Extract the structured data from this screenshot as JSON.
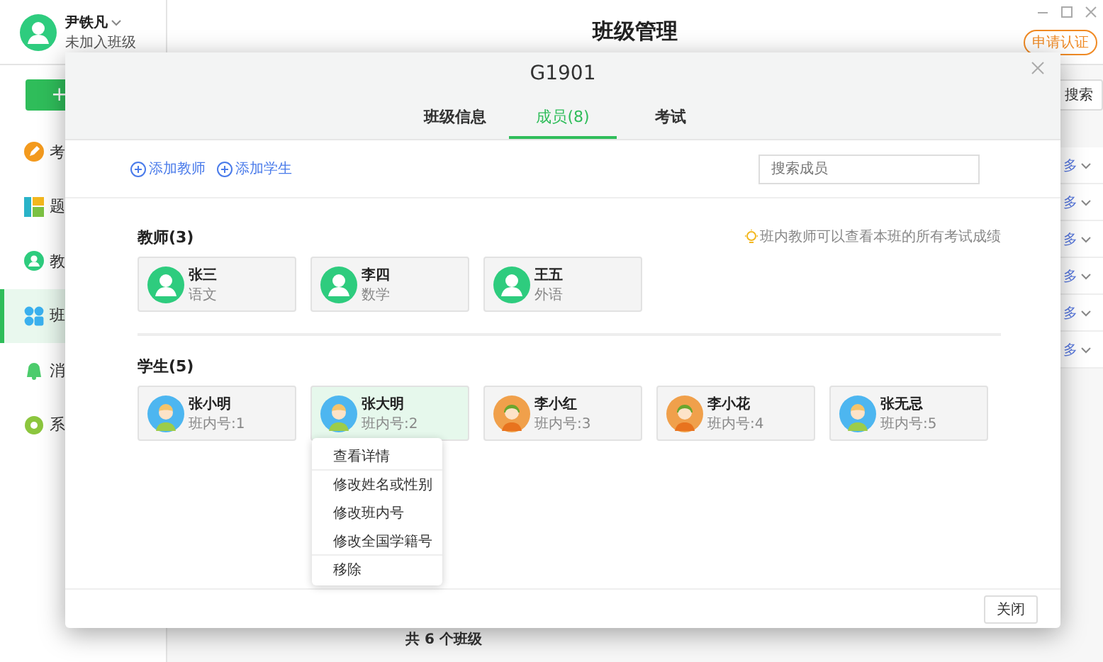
{
  "app": {
    "user": {
      "name": "尹铁凡",
      "status": "未加入班级"
    },
    "add_button": "+",
    "sidebar": {
      "items": [
        {
          "label": "考",
          "kind": "exam",
          "selected": false
        },
        {
          "label": "题",
          "kind": "bank",
          "selected": false
        },
        {
          "label": "教",
          "kind": "teacher",
          "selected": false
        },
        {
          "label": "班",
          "kind": "class",
          "selected": true
        },
        {
          "label": "消",
          "kind": "message",
          "selected": false
        },
        {
          "label": "系",
          "kind": "settings",
          "selected": false
        }
      ]
    },
    "title": "班级管理",
    "badge": "申请认证",
    "search_button": "搜索",
    "rows": [
      {
        "link": "多"
      },
      {
        "link": "多"
      },
      {
        "link": "多"
      },
      {
        "link": "多"
      },
      {
        "link": "多"
      },
      {
        "link": "多"
      }
    ],
    "footer": "共 6 个班级"
  },
  "dialog": {
    "title": "G1901",
    "tabs": [
      {
        "label": "班级信息",
        "selected": false
      },
      {
        "label": "成员(8)",
        "selected": true
      },
      {
        "label": "考试",
        "selected": false
      }
    ],
    "actions": [
      "添加教师",
      "添加学生"
    ],
    "search": {
      "placeholder": "搜索成员"
    },
    "teachers": {
      "heading": "教师(3)",
      "hint": "班内教师可以查看本班的所有考试成绩",
      "members": [
        {
          "name": "张三",
          "detail": "语文"
        },
        {
          "name": "李四",
          "detail": "数学"
        },
        {
          "name": "王五",
          "detail": "外语"
        }
      ]
    },
    "students": {
      "heading": "学生(5)",
      "members": [
        {
          "name": "张小明",
          "detail": "班内号:1",
          "kind": "boy",
          "selected": false
        },
        {
          "name": "张大明",
          "detail": "班内号:2",
          "kind": "boy",
          "selected": true
        },
        {
          "name": "李小红",
          "detail": "班内号:3",
          "kind": "girl",
          "selected": false
        },
        {
          "name": "李小花",
          "detail": "班内号:4",
          "kind": "girl",
          "selected": false
        },
        {
          "name": "张无忌",
          "detail": "班内号:5",
          "kind": "boy",
          "selected": false
        }
      ]
    },
    "menu": {
      "items": [
        {
          "label": "查看详情",
          "separated": false
        },
        {
          "label": "修改姓名或性别",
          "separated": true
        },
        {
          "label": "修改班内号",
          "separated": false
        },
        {
          "label": "修改全国学籍号",
          "separated": false
        },
        {
          "label": "移除",
          "separated": true
        }
      ]
    },
    "close_button": "关闭"
  }
}
